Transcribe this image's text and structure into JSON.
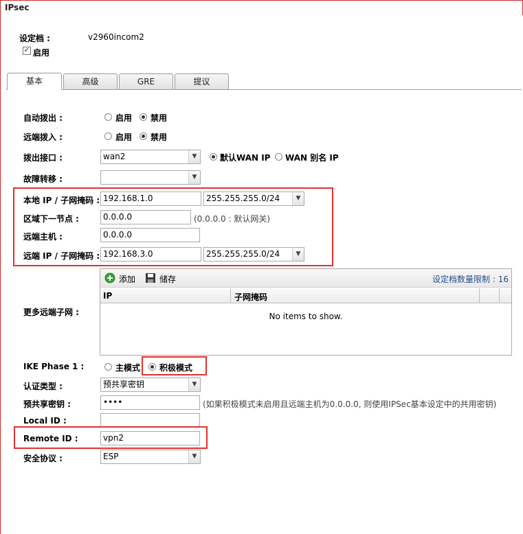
{
  "window": {
    "title": "IPsec"
  },
  "profile": {
    "label": "设定档 :",
    "value": "v2960incom2",
    "enable_label": "启用",
    "enabled": true
  },
  "tabs": [
    {
      "label": "基本",
      "active": true
    },
    {
      "label": "高级",
      "active": false
    },
    {
      "label": "GRE",
      "active": false
    },
    {
      "label": "提议",
      "active": false
    }
  ],
  "auto_dialout": {
    "label": "自动拨出 :",
    "opt_enable": "启用",
    "opt_disable": "禁用",
    "selected": "禁用"
  },
  "remote_dialin": {
    "label": "远端拨入 :",
    "opt_enable": "启用",
    "opt_disable": "禁用",
    "selected": "禁用"
  },
  "dialout_interface": {
    "label": "拨出接口 :",
    "value": "wan2",
    "opt_default_wan_ip": "默认WAN IP",
    "opt_wan_alias_ip": "WAN 别名 IP",
    "selected": "默认WAN IP"
  },
  "failover": {
    "label": "故障转移 :",
    "value": ""
  },
  "local_ip": {
    "label": "本地 IP / 子网掩码 :",
    "ip": "192.168.1.0",
    "mask": "255.255.255.0/24"
  },
  "next_hop": {
    "label": "区域下一节点 :",
    "value": "0.0.0.0",
    "hint": "(0.0.0.0 : 默认网关)"
  },
  "remote_host": {
    "label": "远端主机 :",
    "value": "0.0.0.0"
  },
  "remote_ip": {
    "label": "远端 IP / 子网掩码 :",
    "ip": "192.168.3.0",
    "mask": "255.255.255.0/24"
  },
  "more_subnets": {
    "label": "更多远端子网 :",
    "add_label": "添加",
    "save_label": "储存",
    "limit_text": "设定档数量限制 : 16",
    "columns": [
      "IP",
      "子网掩码"
    ],
    "empty_text": "No items to show."
  },
  "ike_phase1": {
    "label": "IKE Phase 1 :",
    "opt_main": "主模式",
    "opt_aggressive": "积极模式",
    "selected": "积极模式"
  },
  "auth_type": {
    "label": "认证类型 :",
    "value": "预共享密钥"
  },
  "psk": {
    "label": "预共享密钥 :",
    "value": "••••",
    "hint": "(如果积极模式未启用且远端主机为0.0.0.0, 则使用IPSec基本设定中的共用密钥)"
  },
  "local_id": {
    "label": "Local ID :",
    "value": ""
  },
  "remote_id": {
    "label": "Remote ID :",
    "value": "vpn2"
  },
  "security_protocol": {
    "label": "安全协议 :",
    "value": "ESP"
  }
}
